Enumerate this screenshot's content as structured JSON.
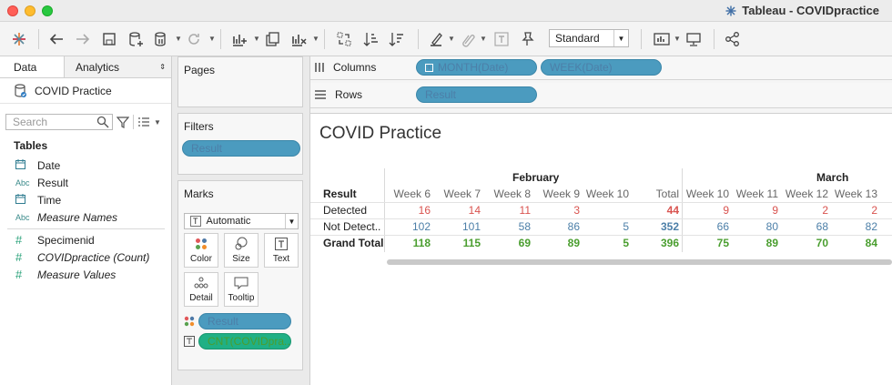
{
  "window": {
    "title": "Tableau - COVIDpractice"
  },
  "toolbar": {
    "fit_mode": "Standard"
  },
  "left_panel": {
    "tabs": [
      "Data",
      "Analytics"
    ],
    "datasource": "COVID Practice",
    "search_placeholder": "Search",
    "tables_heading": "Tables",
    "dimensions": [
      {
        "type": "date",
        "name": "Date"
      },
      {
        "type": "Abc",
        "name": "Result"
      },
      {
        "type": "date",
        "name": "Time"
      },
      {
        "type": "Abc",
        "name": "Measure Names"
      }
    ],
    "measures": [
      {
        "type": "#",
        "name": "Specimenid"
      },
      {
        "type": "#",
        "name": "COVIDpractice (Count)"
      },
      {
        "type": "#",
        "name": "Measure Values"
      }
    ]
  },
  "shelves": {
    "pages_label": "Pages",
    "filters_label": "Filters",
    "filter_pill": "Result",
    "marks_label": "Marks",
    "mark_type": "Automatic",
    "mark_buttons": [
      "Color",
      "Size",
      "Text",
      "Detail",
      "Tooltip"
    ],
    "marks_pills": [
      "Result",
      "CNT(COVIDpra.."
    ],
    "columns_label": "Columns",
    "columns_pills": [
      "MONTH(Date)",
      "WEEK(Date)"
    ],
    "rows_label": "Rows",
    "rows_pills": [
      "Result"
    ]
  },
  "view": {
    "title": "COVID Practice",
    "months": [
      "February",
      "March"
    ],
    "row_header": "Result",
    "columns": [
      "Week 6",
      "Week 7",
      "Week 8",
      "Week 9",
      "Week 10",
      "Total",
      "Week 10",
      "Week 11",
      "Week 12",
      "Week 13"
    ],
    "rows": [
      {
        "label": "Detected",
        "values": [
          "16",
          "14",
          "11",
          "3",
          "",
          "44",
          "9",
          "9",
          "2",
          "2"
        ]
      },
      {
        "label": "Not Detect..",
        "values": [
          "102",
          "101",
          "58",
          "86",
          "5",
          "352",
          "66",
          "80",
          "68",
          "82"
        ]
      },
      {
        "label": "Grand Total",
        "values": [
          "118",
          "115",
          "69",
          "89",
          "5",
          "396",
          "75",
          "89",
          "70",
          "84"
        ]
      }
    ]
  }
}
